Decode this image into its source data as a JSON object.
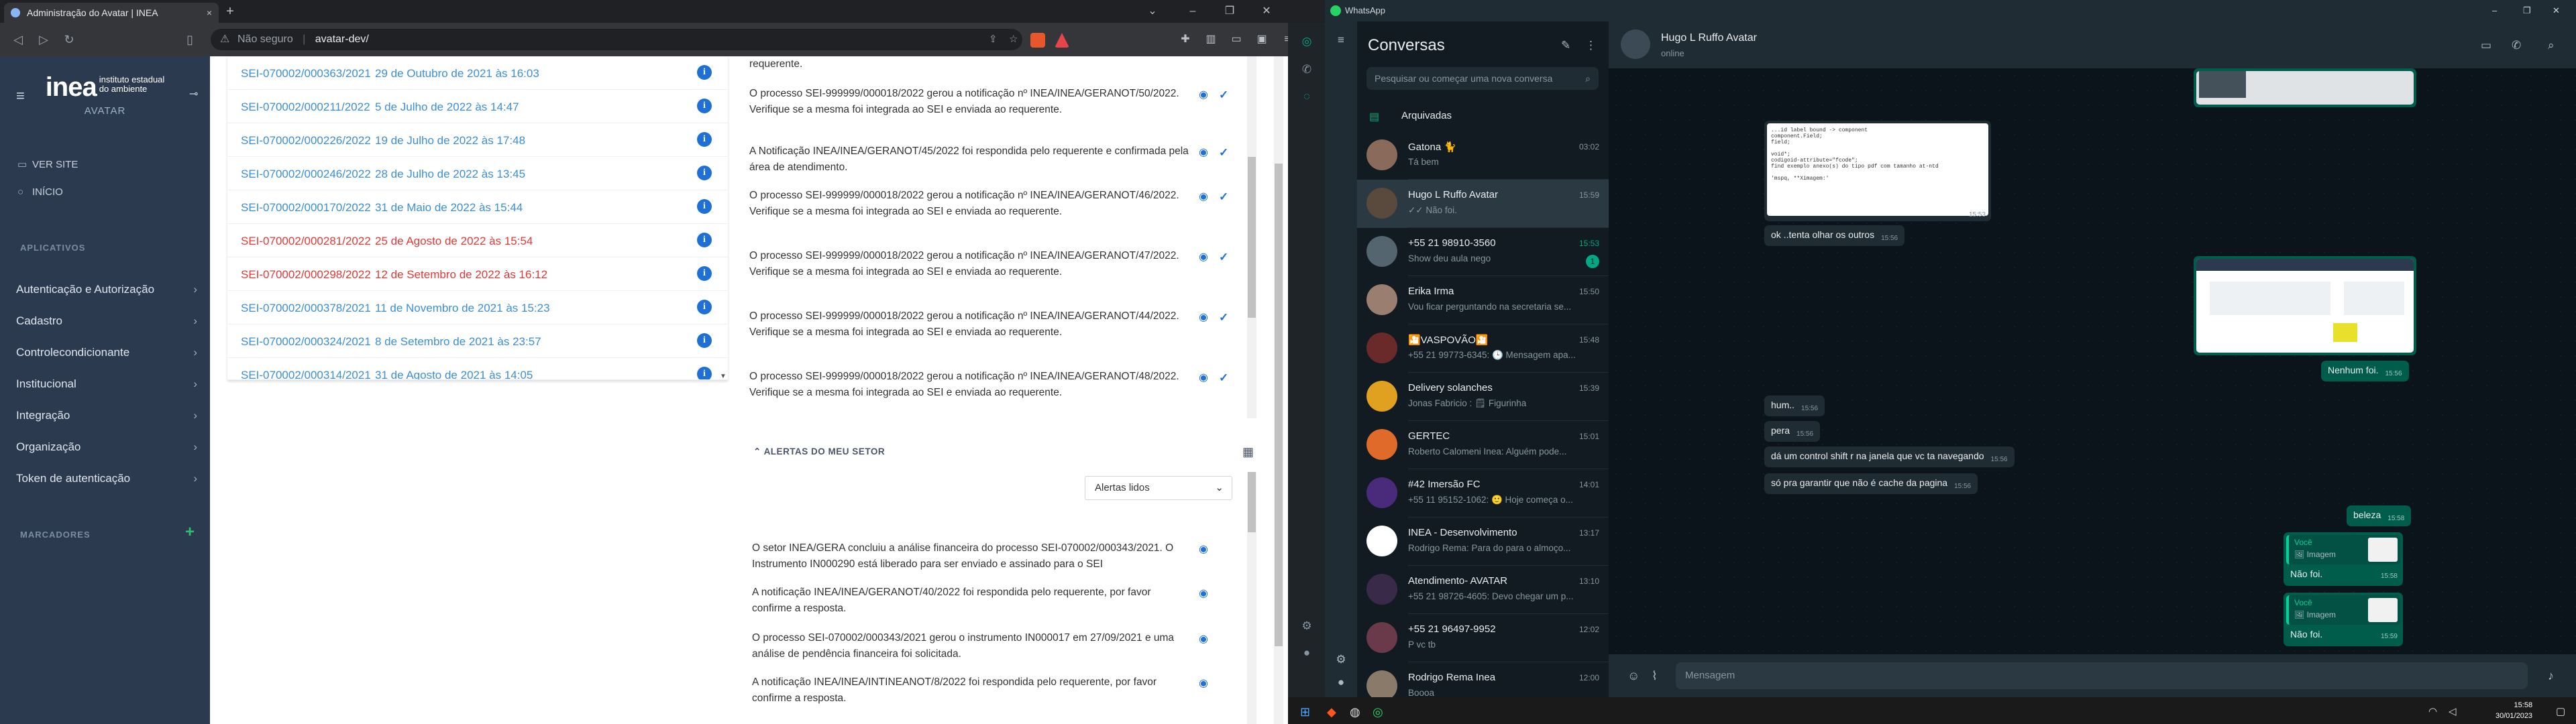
{
  "browser": {
    "tab_title": "Administração do Avatar | INEA",
    "close": "×",
    "new_tab": "+",
    "security": "Não seguro",
    "url": "avatar-dev/"
  },
  "sidebar": {
    "logo": "inea",
    "logo_sub1": "instituto estadual",
    "logo_sub2": "do ambiente",
    "app": "AVATAR",
    "links": [
      {
        "label": "VER SITE"
      },
      {
        "label": "INÍCIO"
      }
    ],
    "section": "APLICATIVOS",
    "menu": [
      "Autenticação e Autorização",
      "Cadastro",
      "Controlecondicionante",
      "Institucional",
      "Integração",
      "Organização",
      "Token de autenticação"
    ],
    "markers": "MARCADORES"
  },
  "processes": [
    {
      "id": "SEI-070002/000363/2021",
      "date": "29 de Outubro de 2021 às 16:03",
      "red": false
    },
    {
      "id": "SEI-070002/000211/2022",
      "date": "5 de Julho de 2022 às 14:47",
      "red": false
    },
    {
      "id": "SEI-070002/000226/2022",
      "date": "19 de Julho de 2022 às 17:48",
      "red": false
    },
    {
      "id": "SEI-070002/000246/2022",
      "date": "28 de Julho de 2022 às 13:45",
      "red": false
    },
    {
      "id": "SEI-070002/000170/2022",
      "date": "31 de Maio de 2022 às 15:44",
      "red": false
    },
    {
      "id": "SEI-070002/000281/2022",
      "date": "25 de Agosto de 2022 às 15:54",
      "red": true
    },
    {
      "id": "SEI-070002/000298/2022",
      "date": "12 de Setembro de 2022 às 16:12",
      "red": true
    },
    {
      "id": "SEI-070002/000378/2021",
      "date": "11 de Novembro de 2021 às 15:23",
      "red": false
    },
    {
      "id": "SEI-070002/000324/2021",
      "date": "8 de Setembro de 2021 às 23:57",
      "red": false
    },
    {
      "id": "SEI-070002/000314/2021",
      "date": "31 de Agosto de 2021 às 14:05",
      "red": false
    }
  ],
  "notifications": [
    {
      "text": "requerente."
    },
    {
      "text": "O processo SEI-999999/000018/2022 gerou a notificação nº INEA/INEA/GERANOT/50/2022. Verifique se a mesma foi integrada ao SEI e enviada ao requerente."
    },
    {
      "text": "A Notificação INEA/INEA/GERANOT/45/2022 foi respondida pelo requerente e confirmada pela área de atendimento."
    },
    {
      "text": "O processo SEI-999999/000018/2022 gerou a notificação nº INEA/INEA/GERANOT/46/2022. Verifique se a mesma foi integrada ao SEI e enviada ao requerente."
    },
    {
      "text": "O processo SEI-999999/000018/2022 gerou a notificação nº INEA/INEA/GERANOT/47/2022. Verifique se a mesma foi integrada ao SEI e enviada ao requerente."
    },
    {
      "text": "O processo SEI-999999/000018/2022 gerou a notificação nº INEA/INEA/GERANOT/44/2022. Verifique se a mesma foi integrada ao SEI e enviada ao requerente."
    },
    {
      "text": "O processo SEI-999999/000018/2022 gerou a notificação nº INEA/INEA/GERANOT/48/2022. Verifique se a mesma foi integrada ao SEI e enviada ao requerente."
    }
  ],
  "alerts": {
    "title": "ALERTAS DO MEU SETOR",
    "filter": "Alertas lidos",
    "items": [
      {
        "text": "O setor INEA/GERA concluiu a análise financeira do processo SEI-070002/000343/2021. O Instrumento IN000290 está liberado para ser enviado e assinado para o SEI"
      },
      {
        "text": "A notificação INEA/INEA/GERANOT/40/2022 foi respondida pelo requerente, por favor confirme a resposta."
      },
      {
        "text": "O processo SEI-070002/000343/2021 gerou o instrumento IN000017 em 27/09/2021 e uma análise de pendência financeira foi solicitada."
      },
      {
        "text": "A notificação INEA/INEA/INTINEANOT/8/2022 foi respondida pelo requerente, por favor confirme a resposta."
      }
    ]
  },
  "whatsapp": {
    "window_title": "WhatsApp",
    "conversations_title": "Conversas",
    "search_placeholder": "Pesquisar ou começar uma nova conversa",
    "archived": "Arquivadas",
    "chats": [
      {
        "name": "Gatona 🐈",
        "preview": "Tá bem",
        "time": "03:02",
        "green": false,
        "badge": "",
        "selected": false,
        "color": "#8a6a5a"
      },
      {
        "name": "Hugo L Ruffo Avatar",
        "preview": "✓✓ Não foi.",
        "time": "15:59",
        "green": false,
        "badge": "",
        "selected": true,
        "color": "#5a4a3e"
      },
      {
        "name": "+55 21 98910-3560",
        "preview": "Show deu aula nego",
        "time": "15:53",
        "green": true,
        "badge": "1",
        "selected": false,
        "color": "#54656f"
      },
      {
        "name": "Erika Irma",
        "preview": "Vou ficar perguntando na secretaria se...",
        "time": "15:50",
        "green": false,
        "badge": "",
        "selected": false,
        "color": "#9a7f70"
      },
      {
        "name": "🎦VASPOVÃO🎦",
        "preview": "+55 21 99773-6345: 🕒 Mensagem apa...",
        "time": "15:48",
        "green": false,
        "badge": "",
        "selected": false,
        "color": "#6b2a2a"
      },
      {
        "name": "Delivery solanches",
        "preview": "Jonas Fabricio : 🗒 Figurinha",
        "time": "15:39",
        "green": false,
        "badge": "",
        "selected": false,
        "color": "#e0a020"
      },
      {
        "name": "GERTEC",
        "preview": "Roberto Calomeni Inea: Alguém pode...",
        "time": "15:01",
        "green": false,
        "badge": "",
        "selected": false,
        "color": "#e06a2a"
      },
      {
        "name": "#42 Imersão FC",
        "preview": "+55 11 95152-1062: 🙂 Hoje começa o...",
        "time": "14:01",
        "green": false,
        "badge": "",
        "selected": false,
        "color": "#4a2a7a"
      },
      {
        "name": "INEA - Desenvolvimento",
        "preview": "Rodrigo Rema: Para do para o almoço...",
        "time": "13:17",
        "green": false,
        "badge": "",
        "selected": false,
        "color": "#ffffff"
      },
      {
        "name": "Atendimento- AVATAR",
        "preview": "+55 21 98726-4605: Devo chegar um p...",
        "time": "13:10",
        "green": false,
        "badge": "",
        "selected": false,
        "color": "#3a2a4a"
      },
      {
        "name": "+55 21 96497-9952",
        "preview": "P vc tb",
        "time": "12:02",
        "green": false,
        "badge": "",
        "selected": false,
        "color": "#6a3a4a"
      },
      {
        "name": "Rodrigo Rema Inea",
        "preview": "Boooa",
        "time": "12:00",
        "green": false,
        "badge": "",
        "selected": false,
        "color": "#8a7a6a"
      }
    ],
    "contact": {
      "name": "Hugo L Ruffo Avatar",
      "status": "online"
    },
    "messages": {
      "m1": "ok ..tenta olhar os outros",
      "m1t": "15:56",
      "m2": "Nenhum foi.",
      "m2t": "15:56",
      "m3": "hum..",
      "m3t": "15:56",
      "m4": "pera",
      "m4t": "15:56",
      "m5": "dá um control shift r na janela que vc ta navegando",
      "m5t": "15:56",
      "m6": "só pra garantir que não é cache da pagina",
      "m6t": "15:56",
      "m7": "beleza",
      "m7t": "15:58",
      "m8": "Não foi.",
      "m8t": "15:58",
      "m9": "Não foi.",
      "m9t": "15:59",
      "img1t": "15:53",
      "img2t": "15:56",
      "quote_who": "Você",
      "quote_what": "🖼 Imagem",
      "code": "...id label bound -> component\ncomponent.Field;\nfield;\n\nvoid*;\ncodigoid-attribute=\"fcode\";\nfind exemplo anexo(s) do tipo pdf com tamanho at-ntd\n\n'mspq, **Ximagem:'"
    },
    "input_placeholder": "Mensagem"
  },
  "taskbar": {
    "time": "15:58",
    "date": "30/01/2023"
  }
}
